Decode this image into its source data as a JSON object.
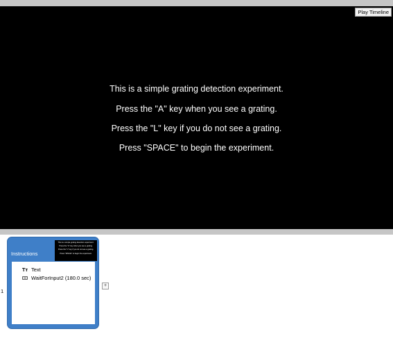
{
  "toolbar": {
    "play_timeline_label": "Play Timeline"
  },
  "stage": {
    "lines": [
      "This is a simple grating detection experiment.",
      "Press the \"A\" key when you see a grating.",
      "Press the \"L\" key if you do not see a grating.",
      "Press \"SPACE\" to begin the experiment."
    ]
  },
  "timeline": {
    "row_number": "1",
    "add_label": "+",
    "card": {
      "title": "Instructions",
      "items": [
        {
          "icon": "text-icon",
          "icon_glyph": "Tт",
          "label": "Text"
        },
        {
          "icon": "keyboard-icon",
          "label": "WaitForInput2 (180.0 sec)"
        }
      ]
    }
  },
  "colors": {
    "card_blue": "#3f7fc8",
    "stage_bg": "#000000",
    "separator_gray": "#c6c6c6"
  }
}
